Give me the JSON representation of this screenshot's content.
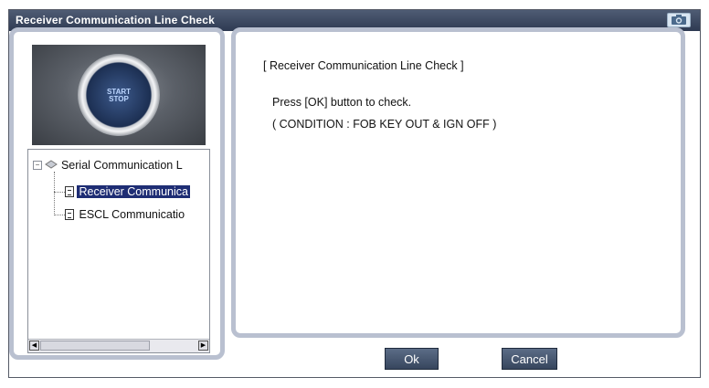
{
  "window": {
    "title": "Receiver Communication Line Check"
  },
  "image": {
    "button_text": "START\nSTOP"
  },
  "tree": {
    "root_label": "Serial Communication L",
    "items": [
      {
        "label": "Receiver Communica",
        "selected": true
      },
      {
        "label": "ESCL Communicatio",
        "selected": false
      }
    ]
  },
  "content": {
    "heading": "[ Receiver Communication Line Check ]",
    "line1": "Press [OK] button to check.",
    "line2": "( CONDITION : FOB KEY OUT & IGN OFF )"
  },
  "buttons": {
    "ok": "Ok",
    "cancel": "Cancel"
  },
  "colors": {
    "titlebar": "#3a4660",
    "panel_border": "#b9c0d0",
    "selection": "#1e2d74",
    "button": "#46566f"
  },
  "icons": {
    "camera": "camera-icon",
    "tree_node": "folder-node-icon",
    "document": "document-icon"
  }
}
